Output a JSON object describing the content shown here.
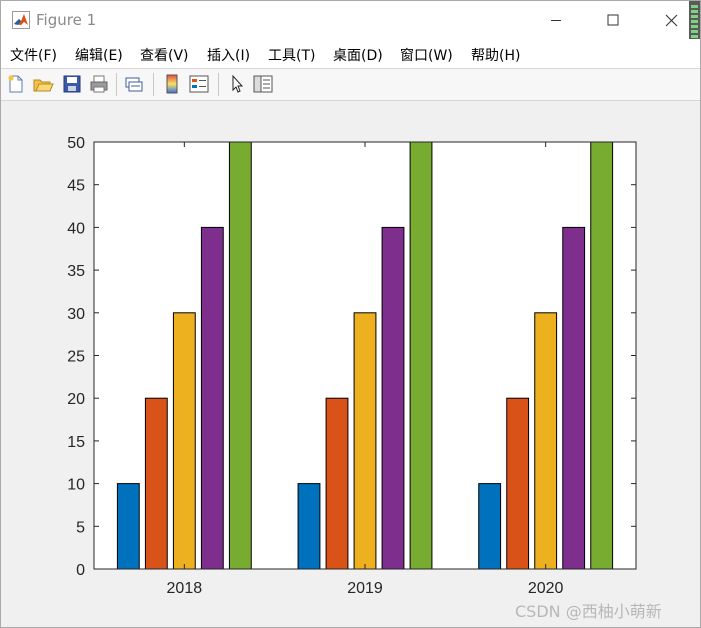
{
  "window": {
    "title": "Figure 1",
    "icon": "matlab-icon"
  },
  "menu": {
    "items": [
      {
        "label": "文件(F)"
      },
      {
        "label": "编辑(E)"
      },
      {
        "label": "查看(V)"
      },
      {
        "label": "插入(I)"
      },
      {
        "label": "工具(T)"
      },
      {
        "label": "桌面(D)"
      },
      {
        "label": "窗口(W)"
      },
      {
        "label": "帮助(H)"
      }
    ]
  },
  "toolbar": {
    "icons": [
      "new-figure-icon",
      "open-file-icon",
      "save-icon",
      "print-icon",
      "link-plot-icon",
      "insert-colorbar-icon",
      "insert-legend-icon",
      "select-arrow-icon",
      "property-inspector-icon"
    ]
  },
  "colors": {
    "series": [
      "#0072BD",
      "#D95319",
      "#EDB120",
      "#7E2F8E",
      "#77AC30"
    ]
  },
  "chart_data": {
    "type": "bar",
    "categories": [
      "2018",
      "2019",
      "2020"
    ],
    "series": [
      {
        "values": [
          10,
          10,
          10
        ]
      },
      {
        "values": [
          20,
          20,
          20
        ]
      },
      {
        "values": [
          30,
          30,
          30
        ]
      },
      {
        "values": [
          40,
          40,
          40
        ]
      },
      {
        "values": [
          50,
          50,
          50
        ]
      }
    ],
    "ylim": [
      0,
      50
    ],
    "yticks": [
      "0",
      "5",
      "10",
      "15",
      "20",
      "25",
      "30",
      "35",
      "40",
      "45",
      "50"
    ],
    "grid": false,
    "title": "",
    "xlabel": "",
    "ylabel": ""
  },
  "watermark": "CSDN @西柚小萌新"
}
